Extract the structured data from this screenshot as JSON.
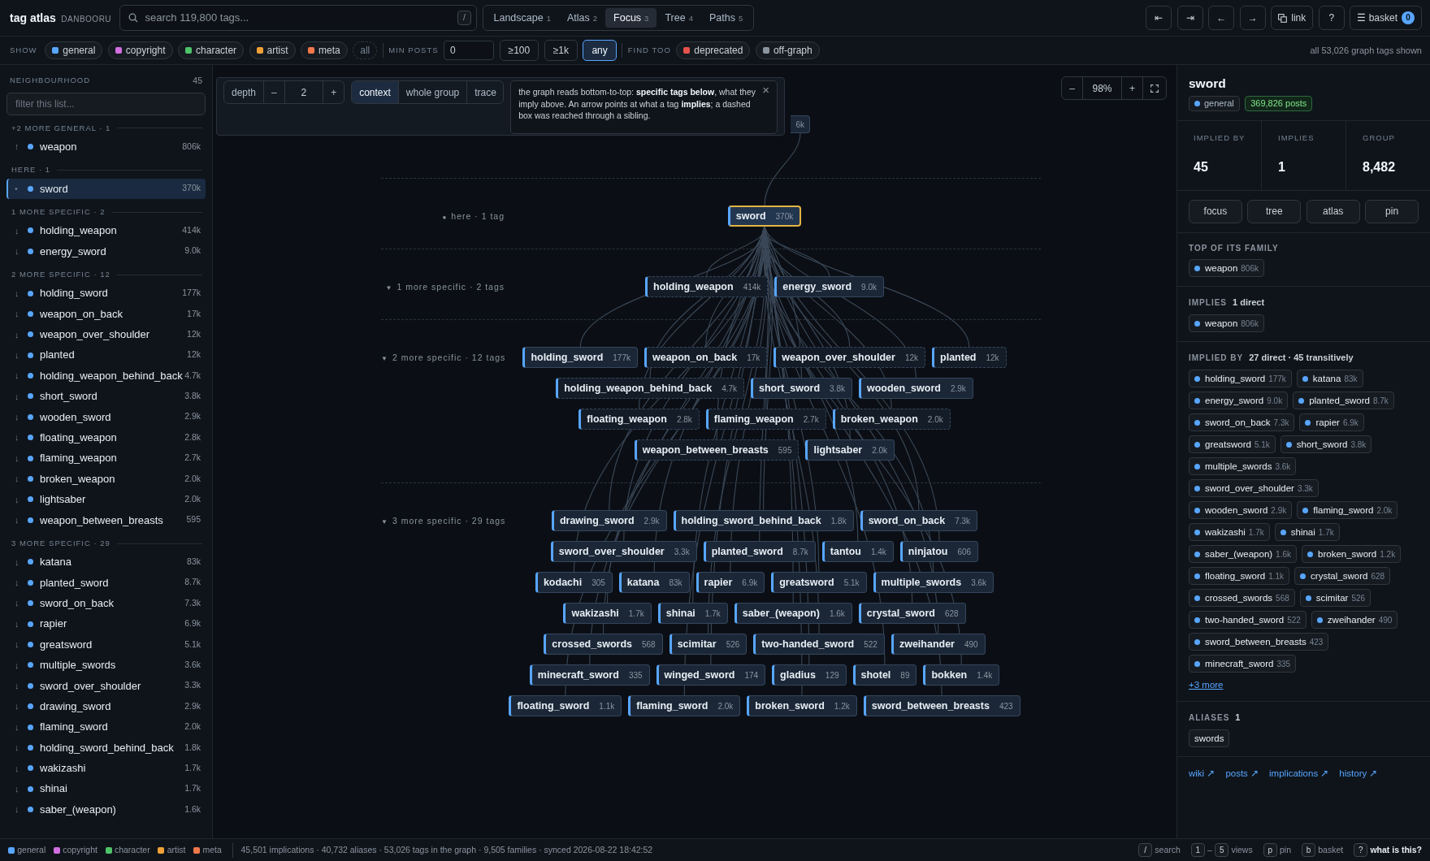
{
  "brand": {
    "title": "tag atlas",
    "subtitle": "DANBOORU"
  },
  "search": {
    "placeholder": "search 119,800 tags...",
    "key": "/"
  },
  "views": [
    {
      "label": "Landscape",
      "key": "1",
      "selected": false
    },
    {
      "label": "Atlas",
      "key": "2",
      "selected": false
    },
    {
      "label": "Focus",
      "key": "3",
      "selected": true
    },
    {
      "label": "Tree",
      "key": "4",
      "selected": false
    },
    {
      "label": "Paths",
      "key": "5",
      "selected": false
    }
  ],
  "toolbar": [
    {
      "label": "⇤",
      "kind": "plain"
    },
    {
      "label": "⇥",
      "kind": "plain"
    },
    {
      "label": "←",
      "kind": "plain"
    },
    {
      "label": "→",
      "kind": "plain"
    },
    {
      "label": "link",
      "kind": "link"
    },
    {
      "label": "?",
      "kind": "plain"
    }
  ],
  "basket": {
    "icon": "☰",
    "label": "basket",
    "count": "0"
  },
  "filters": {
    "show_label": "SHOW",
    "categories": [
      {
        "label": "general",
        "color": "#58a6ff",
        "on": true
      },
      {
        "label": "copyright",
        "color": "#d36ee0",
        "on": true
      },
      {
        "label": "character",
        "color": "#4ec46a",
        "on": true
      },
      {
        "label": "artist",
        "color": "#f0a236",
        "on": true
      },
      {
        "label": "meta",
        "color": "#f0784a",
        "on": true
      }
    ],
    "all": "all",
    "min_posts_label": "MIN POSTS",
    "min_posts": "0",
    "thresholds": [
      {
        "label": "≥100",
        "selected": false
      },
      {
        "label": "≥1k",
        "selected": false
      },
      {
        "label": "any",
        "selected": true
      }
    ],
    "find_label": "FIND TOO",
    "extras": [
      {
        "label": "deprecated",
        "color": "#e5534b",
        "on": true
      },
      {
        "label": "off-graph",
        "color": "#8b949e",
        "on": true
      }
    ],
    "summary": "all 53,026 graph tags shown"
  },
  "sidebar": {
    "title": "NEIGHBOURHOOD",
    "count": "45",
    "filter_placeholder": "filter this list...",
    "groups": [
      {
        "label": "+2 MORE GENERAL · 1",
        "items": [
          {
            "arrow": "↑",
            "name": "weapon",
            "count": "806k",
            "selected": false
          }
        ]
      },
      {
        "label": "HERE · 1",
        "items": [
          {
            "arrow": "•",
            "name": "sword",
            "count": "370k",
            "selected": true
          }
        ]
      },
      {
        "label": "1 MORE SPECIFIC · 2",
        "items": [
          {
            "arrow": "↓",
            "name": "holding_weapon",
            "count": "414k",
            "selected": false
          },
          {
            "arrow": "↓",
            "name": "energy_sword",
            "count": "9.0k",
            "selected": false
          }
        ]
      },
      {
        "label": "2 MORE SPECIFIC · 12",
        "items": [
          {
            "arrow": "↓",
            "name": "holding_sword",
            "count": "177k",
            "selected": false
          },
          {
            "arrow": "↓",
            "name": "weapon_on_back",
            "count": "17k",
            "selected": false
          },
          {
            "arrow": "↓",
            "name": "weapon_over_shoulder",
            "count": "12k",
            "selected": false
          },
          {
            "arrow": "↓",
            "name": "planted",
            "count": "12k",
            "selected": false
          },
          {
            "arrow": "↓",
            "name": "holding_weapon_behind_back",
            "count": "4.7k",
            "selected": false
          },
          {
            "arrow": "↓",
            "name": "short_sword",
            "count": "3.8k",
            "selected": false
          },
          {
            "arrow": "↓",
            "name": "wooden_sword",
            "count": "2.9k",
            "selected": false
          },
          {
            "arrow": "↓",
            "name": "floating_weapon",
            "count": "2.8k",
            "selected": false
          },
          {
            "arrow": "↓",
            "name": "flaming_weapon",
            "count": "2.7k",
            "selected": false
          },
          {
            "arrow": "↓",
            "name": "broken_weapon",
            "count": "2.0k",
            "selected": false
          },
          {
            "arrow": "↓",
            "name": "lightsaber",
            "count": "2.0k",
            "selected": false
          },
          {
            "arrow": "↓",
            "name": "weapon_between_breasts",
            "count": "595",
            "selected": false
          }
        ]
      },
      {
        "label": "3 MORE SPECIFIC · 29",
        "items": [
          {
            "arrow": "↓",
            "name": "katana",
            "count": "83k",
            "selected": false
          },
          {
            "arrow": "↓",
            "name": "planted_sword",
            "count": "8.7k",
            "selected": false
          },
          {
            "arrow": "↓",
            "name": "sword_on_back",
            "count": "7.3k",
            "selected": false
          },
          {
            "arrow": "↓",
            "name": "rapier",
            "count": "6.9k",
            "selected": false
          },
          {
            "arrow": "↓",
            "name": "greatsword",
            "count": "5.1k",
            "selected": false
          },
          {
            "arrow": "↓",
            "name": "multiple_swords",
            "count": "3.6k",
            "selected": false
          },
          {
            "arrow": "↓",
            "name": "sword_over_shoulder",
            "count": "3.3k",
            "selected": false
          },
          {
            "arrow": "↓",
            "name": "drawing_sword",
            "count": "2.9k",
            "selected": false
          },
          {
            "arrow": "↓",
            "name": "flaming_sword",
            "count": "2.0k",
            "selected": false
          },
          {
            "arrow": "↓",
            "name": "holding_sword_behind_back",
            "count": "1.8k",
            "selected": false
          },
          {
            "arrow": "↓",
            "name": "wakizashi",
            "count": "1.7k",
            "selected": false
          },
          {
            "arrow": "↓",
            "name": "shinai",
            "count": "1.7k",
            "selected": false
          },
          {
            "arrow": "↓",
            "name": "saber_(weapon)",
            "count": "1.6k",
            "selected": false
          }
        ]
      }
    ]
  },
  "graph_controls": {
    "depth_label": "depth",
    "minus": "–",
    "depth": "2",
    "plus": "+",
    "modes": [
      {
        "label": "context",
        "selected": true
      },
      {
        "label": "whole group",
        "selected": false
      },
      {
        "label": "trace",
        "selected": false
      }
    ],
    "hint": "the graph reads bottom-to-top: **specific tags below**, what they imply above. An arrow points at what a tag **implies**; a dashed box was reached through a sibling.",
    "close": "×"
  },
  "zoom": {
    "minus": "–",
    "level": "98%",
    "plus": "+"
  },
  "graph": {
    "top_node": {
      "count": "6k"
    },
    "layers": [
      {
        "marker": "●",
        "label": "here · 1 tag",
        "rows": [
          {
            "nodes": [
              {
                "name": "sword",
                "count": "370k",
                "selected": true,
                "via_sibling": false
              }
            ]
          }
        ]
      },
      {
        "marker": "▼",
        "label": "1 more specific · 2 tags",
        "rows": [
          {
            "nodes": [
              {
                "name": "holding_weapon",
                "count": "414k",
                "selected": false,
                "via_sibling": true
              },
              {
                "name": "energy_sword",
                "count": "9.0k",
                "selected": false,
                "via_sibling": false
              }
            ]
          }
        ]
      },
      {
        "marker": "▼",
        "label": "2 more specific · 12 tags",
        "rows": [
          {
            "nodes": [
              {
                "name": "holding_sword",
                "count": "177k",
                "selected": false,
                "via_sibling": false
              },
              {
                "name": "weapon_on_back",
                "count": "17k",
                "selected": false,
                "via_sibling": true
              },
              {
                "name": "weapon_over_shoulder",
                "count": "12k",
                "selected": false,
                "via_sibling": true
              },
              {
                "name": "planted",
                "count": "12k",
                "selected": false,
                "via_sibling": true
              }
            ]
          },
          {
            "nodes": [
              {
                "name": "holding_weapon_behind_back",
                "count": "4.7k",
                "selected": false,
                "via_sibling": true
              },
              {
                "name": "short_sword",
                "count": "3.8k",
                "selected": false,
                "via_sibling": false
              },
              {
                "name": "wooden_sword",
                "count": "2.9k",
                "selected": false,
                "via_sibling": false
              }
            ]
          },
          {
            "nodes": [
              {
                "name": "floating_weapon",
                "count": "2.8k",
                "selected": false,
                "via_sibling": true
              },
              {
                "name": "flaming_weapon",
                "count": "2.7k",
                "selected": false,
                "via_sibling": true
              },
              {
                "name": "broken_weapon",
                "count": "2.0k",
                "selected": false,
                "via_sibling": true
              }
            ]
          },
          {
            "nodes": [
              {
                "name": "weapon_between_breasts",
                "count": "595",
                "selected": false,
                "via_sibling": true
              },
              {
                "name": "lightsaber",
                "count": "2.0k",
                "selected": false,
                "via_sibling": false
              }
            ]
          }
        ]
      },
      {
        "marker": "▼",
        "label": "3 more specific · 29 tags",
        "rows": [
          {
            "nodes": [
              {
                "name": "drawing_sword",
                "count": "2.9k",
                "selected": false,
                "via_sibling": false
              },
              {
                "name": "holding_sword_behind_back",
                "count": "1.8k",
                "selected": false,
                "via_sibling": false
              },
              {
                "name": "sword_on_back",
                "count": "7.3k",
                "selected": false,
                "via_sibling": false
              }
            ]
          },
          {
            "nodes": [
              {
                "name": "sword_over_shoulder",
                "count": "3.3k",
                "selected": false,
                "via_sibling": false
              },
              {
                "name": "planted_sword",
                "count": "8.7k",
                "selected": false,
                "via_sibling": false
              },
              {
                "name": "tantou",
                "count": "1.4k",
                "selected": false,
                "via_sibling": false
              },
              {
                "name": "ninjatou",
                "count": "606",
                "selected": false,
                "via_sibling": false
              }
            ]
          },
          {
            "nodes": [
              {
                "name": "kodachi",
                "count": "305",
                "selected": false,
                "via_sibling": false
              },
              {
                "name": "katana",
                "count": "83k",
                "selected": false,
                "via_sibling": false
              },
              {
                "name": "rapier",
                "count": "6.9k",
                "selected": false,
                "via_sibling": false
              },
              {
                "name": "greatsword",
                "count": "5.1k",
                "selected": false,
                "via_sibling": false
              },
              {
                "name": "multiple_swords",
                "count": "3.6k",
                "selected": false,
                "via_sibling": false
              }
            ]
          },
          {
            "nodes": [
              {
                "name": "wakizashi",
                "count": "1.7k",
                "selected": false,
                "via_sibling": false
              },
              {
                "name": "shinai",
                "count": "1.7k",
                "selected": false,
                "via_sibling": false
              },
              {
                "name": "saber_(weapon)",
                "count": "1.6k",
                "selected": false,
                "via_sibling": false
              },
              {
                "name": "crystal_sword",
                "count": "628",
                "selected": false,
                "via_sibling": false
              }
            ]
          },
          {
            "nodes": [
              {
                "name": "crossed_swords",
                "count": "568",
                "selected": false,
                "via_sibling": false
              },
              {
                "name": "scimitar",
                "count": "526",
                "selected": false,
                "via_sibling": false
              },
              {
                "name": "two-handed_sword",
                "count": "522",
                "selected": false,
                "via_sibling": false
              },
              {
                "name": "zweihander",
                "count": "490",
                "selected": false,
                "via_sibling": false
              }
            ]
          },
          {
            "nodes": [
              {
                "name": "minecraft_sword",
                "count": "335",
                "selected": false,
                "via_sibling": false
              },
              {
                "name": "winged_sword",
                "count": "174",
                "selected": false,
                "via_sibling": false
              },
              {
                "name": "gladius",
                "count": "129",
                "selected": false,
                "via_sibling": false
              },
              {
                "name": "shotel",
                "count": "89",
                "selected": false,
                "via_sibling": false
              },
              {
                "name": "bokken",
                "count": "1.4k",
                "selected": false,
                "via_sibling": false
              }
            ]
          },
          {
            "nodes": [
              {
                "name": "floating_sword",
                "count": "1.1k",
                "selected": false,
                "via_sibling": false
              },
              {
                "name": "flaming_sword",
                "count": "2.0k",
                "selected": false,
                "via_sibling": false
              },
              {
                "name": "broken_sword",
                "count": "1.2k",
                "selected": false,
                "via_sibling": false
              },
              {
                "name": "sword_between_breasts",
                "count": "423",
                "selected": false,
                "via_sibling": false
              }
            ]
          }
        ]
      }
    ]
  },
  "details": {
    "title": "sword",
    "category": "general",
    "posts": "369,826 posts",
    "stats": [
      {
        "label": "IMPLIED BY",
        "value": "45"
      },
      {
        "label": "IMPLIES",
        "value": "1"
      },
      {
        "label": "GROUP",
        "value": "8,482"
      }
    ],
    "actions": [
      "focus",
      "tree",
      "atlas",
      "pin"
    ],
    "sections": [
      {
        "label": "TOP OF ITS FAMILY",
        "tags": [
          {
            "name": "weapon",
            "count": "806k"
          }
        ]
      },
      {
        "label": "IMPLIES",
        "note": "1 direct",
        "tags": [
          {
            "name": "weapon",
            "count": "806k"
          }
        ]
      },
      {
        "label": "IMPLIED BY",
        "note": "27 direct · 45 transitively",
        "tags": [
          {
            "name": "holding_sword",
            "count": "177k"
          },
          {
            "name": "katana",
            "count": "83k"
          },
          {
            "name": "energy_sword",
            "count": "9.0k"
          },
          {
            "name": "planted_sword",
            "count": "8.7k"
          },
          {
            "name": "sword_on_back",
            "count": "7.3k"
          },
          {
            "name": "rapier",
            "count": "6.9k"
          },
          {
            "name": "greatsword",
            "count": "5.1k"
          },
          {
            "name": "short_sword",
            "count": "3.8k"
          },
          {
            "name": "multiple_swords",
            "count": "3.6k"
          },
          {
            "name": "sword_over_shoulder",
            "count": "3.3k"
          },
          {
            "name": "wooden_sword",
            "count": "2.9k"
          },
          {
            "name": "flaming_sword",
            "count": "2.0k"
          },
          {
            "name": "wakizashi",
            "count": "1.7k"
          },
          {
            "name": "shinai",
            "count": "1.7k"
          },
          {
            "name": "saber_(weapon)",
            "count": "1.6k"
          },
          {
            "name": "broken_sword",
            "count": "1.2k"
          },
          {
            "name": "floating_sword",
            "count": "1.1k"
          },
          {
            "name": "crystal_sword",
            "count": "628"
          },
          {
            "name": "crossed_swords",
            "count": "568"
          },
          {
            "name": "scimitar",
            "count": "526"
          },
          {
            "name": "two-handed_sword",
            "count": "522"
          },
          {
            "name": "zweihander",
            "count": "490"
          },
          {
            "name": "sword_between_breasts",
            "count": "423"
          },
          {
            "name": "minecraft_sword",
            "count": "335"
          }
        ],
        "more": "+3 more"
      },
      {
        "label": "ALIASES",
        "note": "1",
        "aliases": [
          "swords"
        ]
      }
    ],
    "links": [
      "wiki ↗",
      "posts ↗",
      "implications ↗",
      "history ↗"
    ]
  },
  "status": {
    "legend": [
      {
        "label": "general",
        "color": "#58a6ff"
      },
      {
        "label": "copyright",
        "color": "#d36ee0"
      },
      {
        "label": "character",
        "color": "#4ec46a"
      },
      {
        "label": "artist",
        "color": "#f0a236"
      },
      {
        "label": "meta",
        "color": "#f0784a"
      }
    ],
    "summary": "45,501 implications · 40,732 aliases · 53,026 tags in the graph · 9,505 families · synced 2026-08-22 18:42:52",
    "shortcuts": [
      {
        "keys": [
          "/"
        ],
        "label": "search",
        "bold": false
      },
      {
        "keys": [
          "1",
          "5"
        ],
        "joiner": "–",
        "label": "views",
        "bold": false
      },
      {
        "keys": [
          "p"
        ],
        "label": "pin",
        "bold": false
      },
      {
        "keys": [
          "b"
        ],
        "label": "basket",
        "bold": false
      },
      {
        "keys": [
          "?"
        ],
        "label": "what is this?",
        "bold": true
      }
    ]
  }
}
